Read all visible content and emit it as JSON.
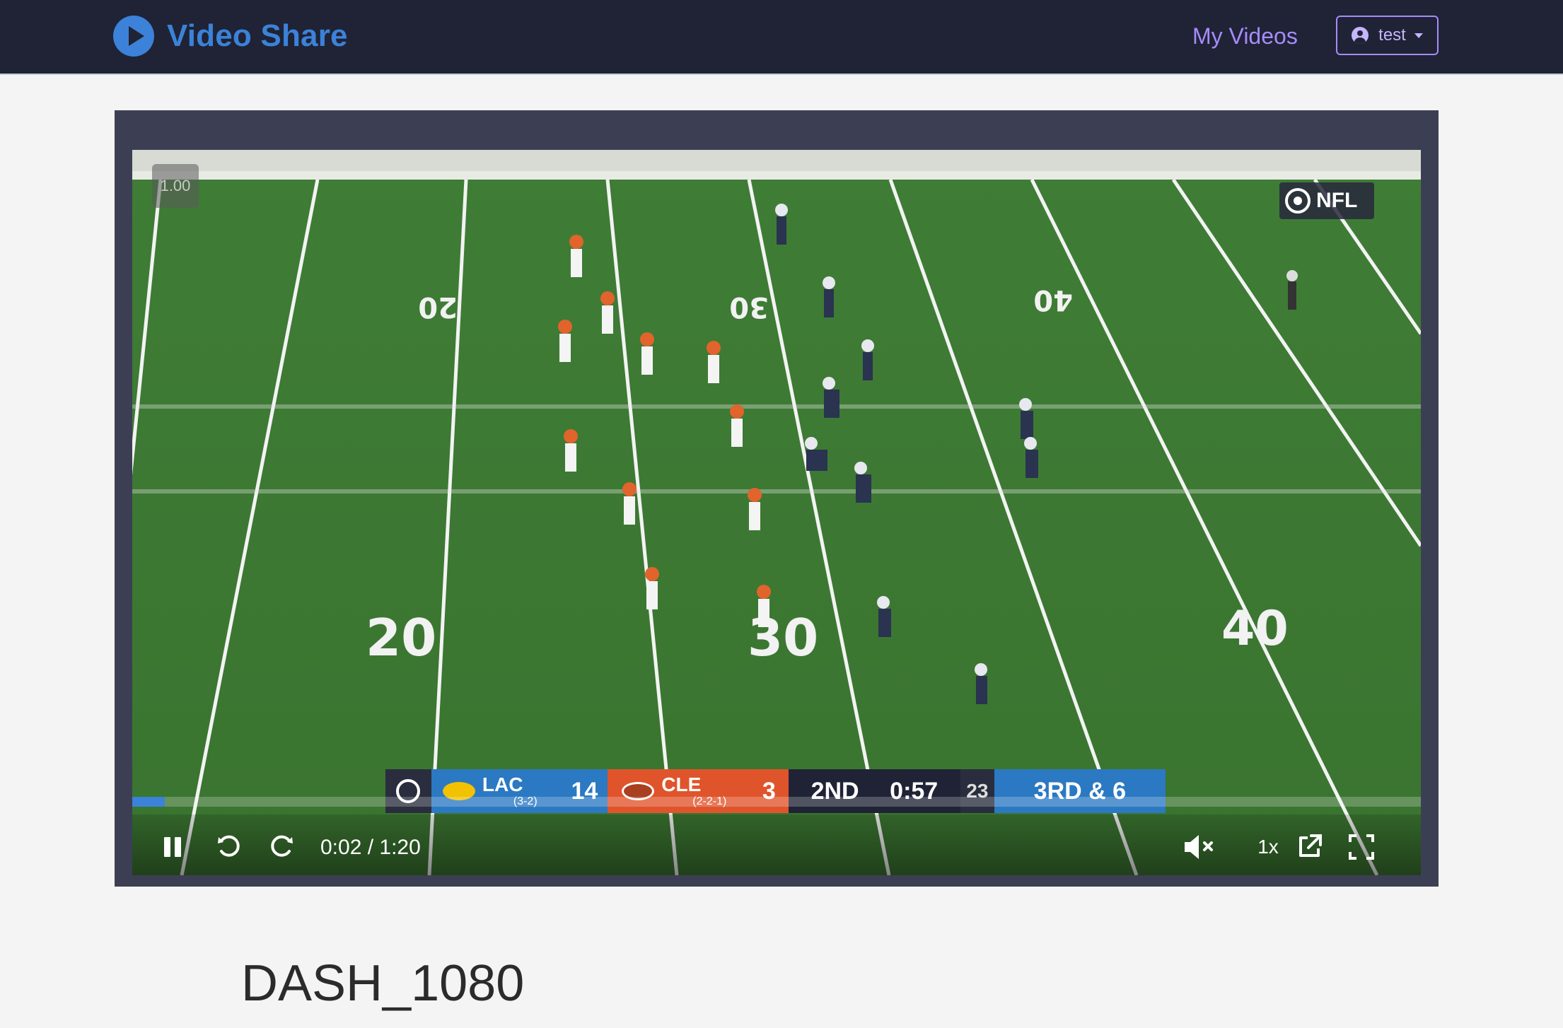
{
  "navbar": {
    "brand": "Video Share",
    "my_videos": "My Videos",
    "user": "test"
  },
  "video": {
    "speed_badge": "1.00",
    "network_bug": "NFL",
    "progress": 0.025,
    "time_display": "0:02 / 1:20",
    "playback_rate": "1x",
    "scorebug": {
      "team1": {
        "abbr": "LAC",
        "record": "(3-2)",
        "score": "14"
      },
      "team2": {
        "abbr": "CLE",
        "record": "(2-2-1)",
        "score": "3"
      },
      "quarter": "2ND",
      "clock": "0:57",
      "play_clock": "23",
      "down_distance": "3RD & 6"
    }
  },
  "page_title": "DASH_1080"
}
